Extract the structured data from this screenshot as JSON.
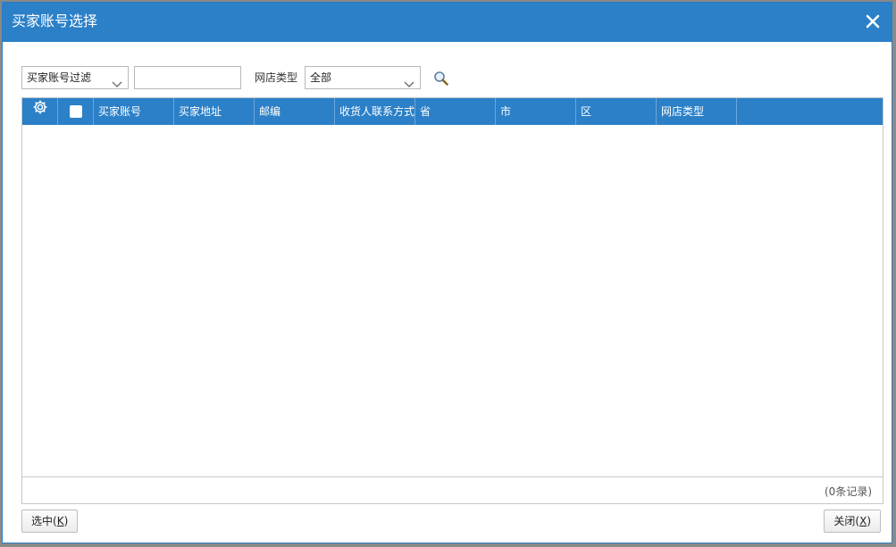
{
  "dialog": {
    "title": "买家账号选择",
    "close_icon": "close-icon"
  },
  "toolbar": {
    "filter_select": {
      "value": "买家账号过滤"
    },
    "filter_input": {
      "value": "",
      "placeholder": ""
    },
    "shop_type_label": "网店类型",
    "shop_type_select": {
      "value": "全部"
    },
    "search_icon": "search-icon"
  },
  "grid": {
    "settings_icon": "gear-icon",
    "columns": [
      "买家账号",
      "买家地址",
      "邮编",
      "收货人联系方式",
      "省",
      "市",
      "区",
      "网店类型"
    ],
    "rows": [],
    "record_count": "(0条记录)"
  },
  "footer": {
    "select_button": {
      "text": "选中(",
      "key": "K",
      "end": ")"
    },
    "close_button": {
      "text": "关闭(",
      "key": "X",
      "end": ")"
    }
  },
  "colors": {
    "accent": "#2b80c8"
  }
}
